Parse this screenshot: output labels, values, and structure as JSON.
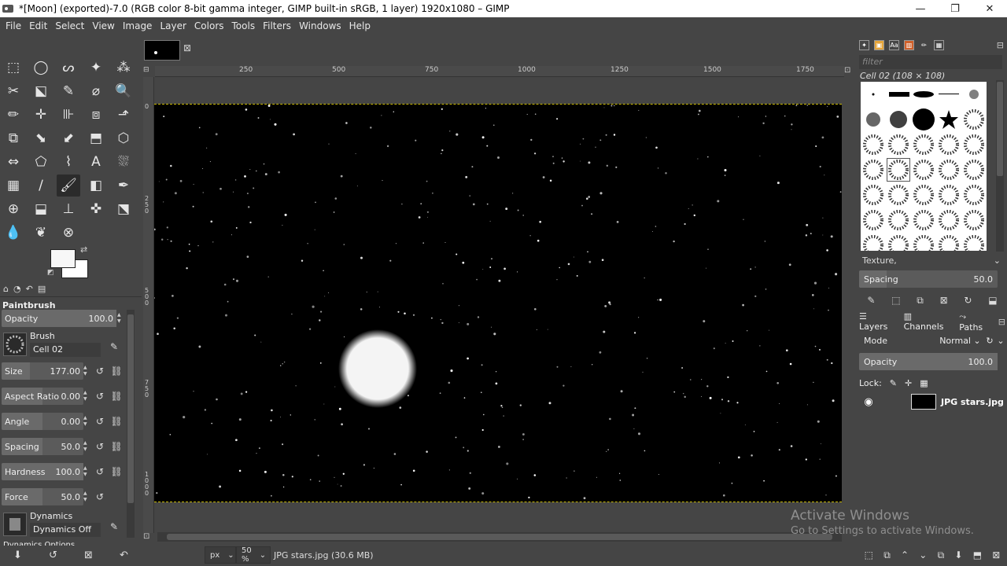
{
  "window": {
    "title": "*[Moon] (exported)-7.0 (RGB color 8-bit gamma integer, GIMP built-in sRGB, 1 layer) 1920x1080 – GIMP",
    "minimize": "—",
    "restore": "❐",
    "close": "✕"
  },
  "menu": [
    "File",
    "Edit",
    "Select",
    "View",
    "Image",
    "Layer",
    "Colors",
    "Tools",
    "Filters",
    "Windows",
    "Help"
  ],
  "tools": [
    "⬚",
    "◯",
    "ᔕ",
    "✦",
    "⁂",
    "✂",
    "⬕",
    "✎",
    "⌀",
    "🔍",
    "✏",
    "✛",
    "⊪",
    "⧈",
    "⬏",
    "⧉",
    "⬊",
    "⬋",
    "⬒",
    "⬡",
    "⇔",
    "⬠",
    "⌇",
    "A",
    "⛆",
    "▦",
    "∕",
    "🖌",
    "◧",
    "✒",
    "⊕",
    "⬓",
    "⊥",
    "✜",
    "⬔",
    "💧",
    "❦",
    "⊗"
  ],
  "active_tool_index": 27,
  "options": {
    "tabs": [
      "⌂",
      "◔",
      "↶",
      "▤"
    ],
    "title": "Paintbrush",
    "opacity_label": "Opacity",
    "opacity_value": "100.0",
    "opacity_frac": 1.0,
    "brush_label": "Brush",
    "brush_name": "Cell 02",
    "size_label": "Size",
    "size_value": "177.00",
    "size_frac": 0.35,
    "aspect_label": "Aspect Ratio",
    "aspect_value": "0.00",
    "aspect_frac": 0.5,
    "angle_label": "Angle",
    "angle_value": "0.00",
    "angle_frac": 0.5,
    "spacing_label": "Spacing",
    "spacing_value": "50.0",
    "spacing_frac": 0.5,
    "hardness_label": "Hardness",
    "hardness_value": "100.0",
    "hardness_frac": 1.0,
    "force_label": "Force",
    "force_value": "50.0",
    "force_frac": 0.5,
    "dynamics_label": "Dynamics",
    "dynamics_name": "Dynamics Off",
    "cut_label": "Dynamics Options",
    "bottom_icons": [
      "⬇",
      "↺",
      "⊠",
      "↶"
    ]
  },
  "canvas": {
    "ruler_labels": [
      "250",
      "500",
      "750",
      "1000",
      "1250",
      "1500",
      "1750"
    ],
    "vruler_labels": [
      "0",
      "250",
      "500",
      "750",
      "1000"
    ],
    "moon_color": "#f4f4f4",
    "bg_color": "#000000"
  },
  "status": {
    "unit": "px",
    "zoom": "50 %",
    "text": "JPG stars.jpg (30.6 MB)"
  },
  "dock": {
    "tabs": [
      "✦",
      "▣",
      "Aa",
      "▥",
      "✏",
      "▦"
    ],
    "filter_placeholder": "filter",
    "brush_name": "Cell 02 (108 × 108)",
    "tag": "Texture,",
    "spacing_label": "Spacing",
    "spacing_value": "50.0",
    "spacing_frac": 0.2,
    "brush_icons": [
      "✎",
      "⬚",
      "⧉",
      "⊠",
      "↻",
      "⬓"
    ],
    "layers_tab": "Layers",
    "channels_tab": "Channels",
    "paths_tab": "Paths",
    "mode_label": "Mode",
    "mode_value": "Normal",
    "opacity_label": "Opacity",
    "opacity_value": "100.0",
    "opacity_frac": 1.0,
    "lock_label": "Lock:",
    "layer_name": "JPG stars.jpg",
    "layer_icons": [
      "⬚",
      "⧉",
      "⌃",
      "⌄",
      "⧉",
      "⬇",
      "⬒",
      "⊠"
    ]
  },
  "watermark": {
    "line1": "Activate Windows",
    "line2": "Go to Settings to activate Windows."
  }
}
